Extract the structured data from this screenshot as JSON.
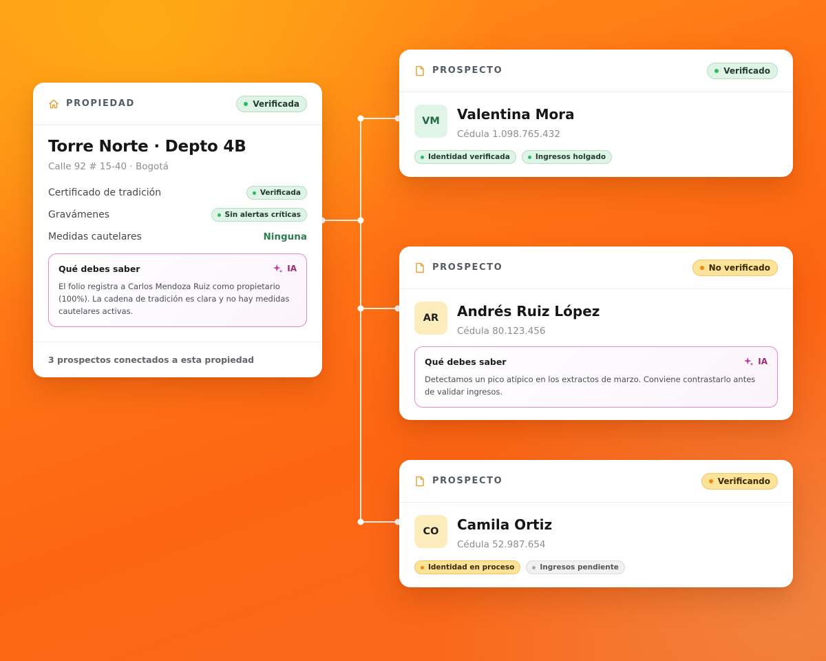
{
  "property": {
    "header": "PROPIEDAD",
    "status": "Verificada",
    "title": "Torre Norte · Depto 4B",
    "address": "Calle 92 # 15-40 · Bogotá",
    "rows": [
      {
        "label": "Certificado de tradición",
        "value": "Verificada"
      },
      {
        "label": "Gravámenes",
        "value": "Sin alertas críticas"
      },
      {
        "label": "Medidas cautelares",
        "value": "Ninguna"
      }
    ],
    "ai": {
      "title": "Qué debes saber",
      "tag": "IA",
      "text": "El folio registra a Carlos Mendoza Ruiz como propietario (100%). La cadena de tradición es clara y no hay medidas cautelares activas."
    },
    "footer": "3 prospectos conectados a esta propiedad"
  },
  "prospects": [
    {
      "header": "PROSPECTO",
      "status": "Verificado",
      "initials": "VM",
      "name": "Valentina Mora",
      "id": "Cédula 1.098.765.432",
      "tags": [
        "Identidad verificada",
        "Ingresos holgado"
      ]
    },
    {
      "header": "PROSPECTO",
      "status": "No verificado",
      "initials": "AR",
      "name": "Andrés Ruiz López",
      "id": "Cédula 80.123.456",
      "ai": {
        "title": "Qué debes saber",
        "tag": "IA",
        "text": "Detectamos un pico atípico en los extractos de marzo. Conviene contrastarlo antes de validar ingresos."
      }
    },
    {
      "header": "PROSPECTO",
      "status": "Verificando",
      "initials": "CO",
      "name": "Camila Ortiz",
      "id": "Cédula 52.987.654",
      "tags": [
        "Identidad en proceso",
        "Ingresos pendiente"
      ]
    }
  ],
  "colors": {
    "accent_orange": "#ff7415",
    "verified_green": "#2fb866",
    "pending_yellow": "#fde29a",
    "ai_magenta": "#9b2a6e"
  }
}
